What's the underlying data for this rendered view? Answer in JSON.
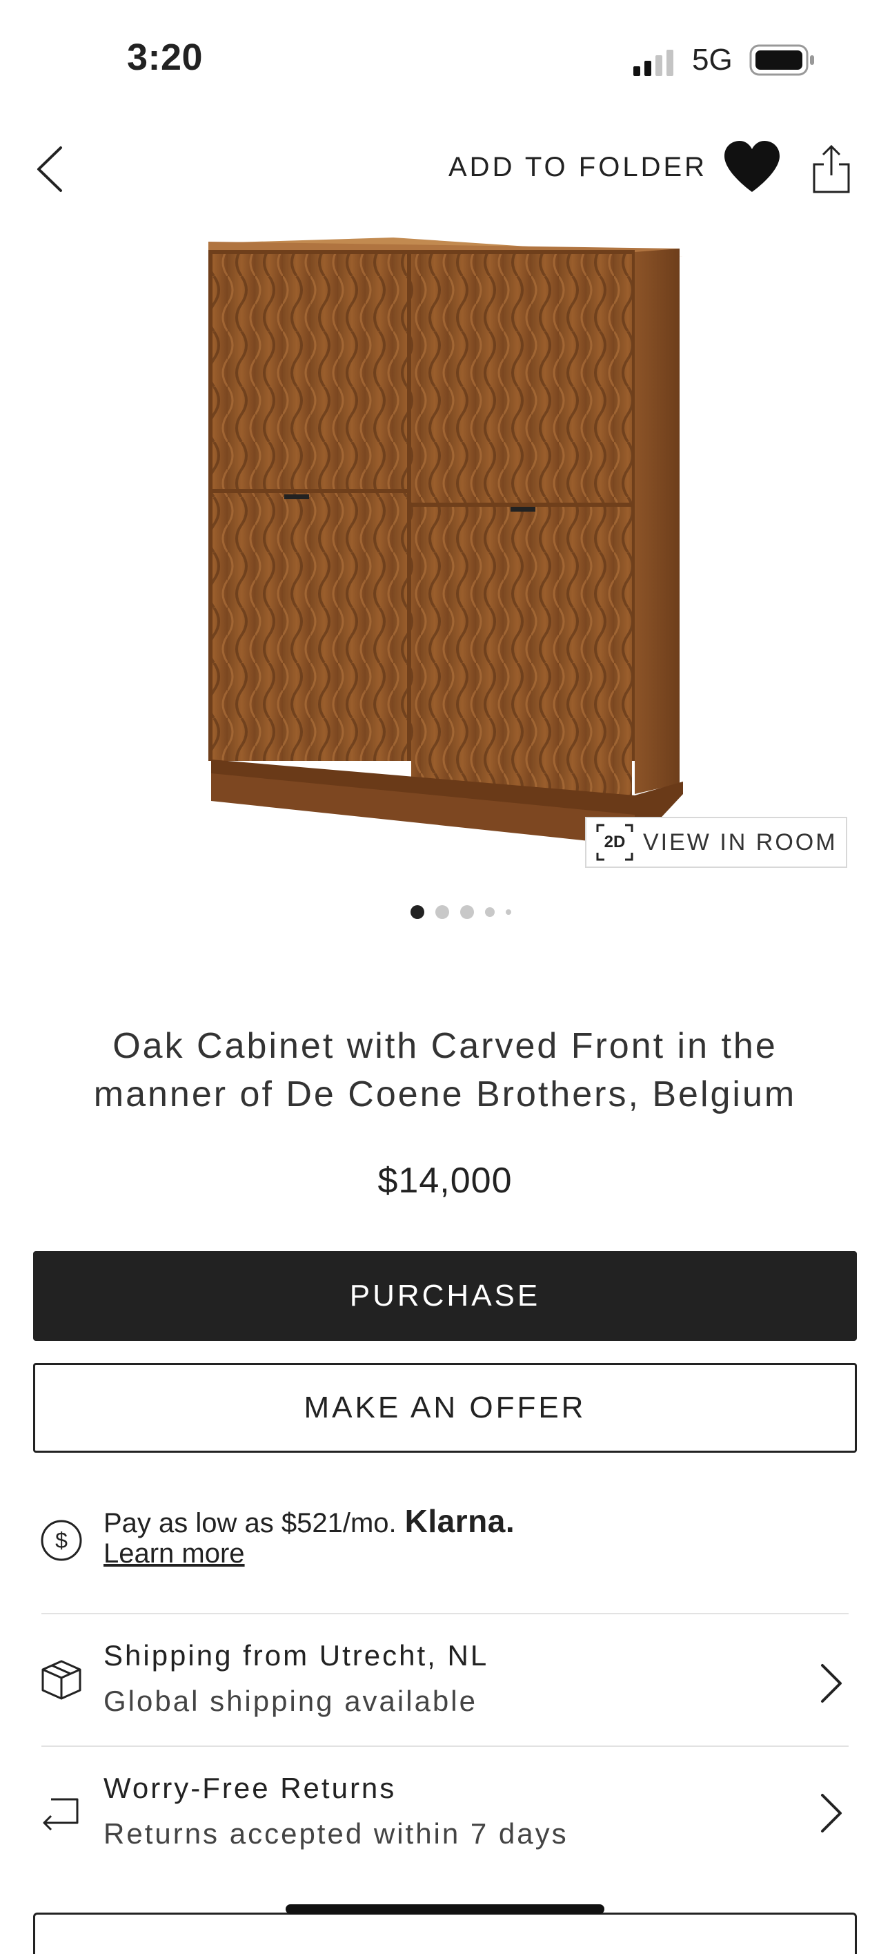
{
  "status_bar": {
    "time": "3:20",
    "network": "5G",
    "icons": [
      "signal-icon",
      "battery-icon"
    ]
  },
  "header": {
    "add_to_folder_label": "ADD TO FOLDER",
    "icons": [
      "back-chevron-icon",
      "heart-icon",
      "share-icon"
    ]
  },
  "product": {
    "view_in_room_label": "VIEW IN ROOM",
    "view_in_room_badge": "2D",
    "image_count": 5,
    "active_image": 1,
    "title": "Oak Cabinet with Carved Front in the manner of De Coene Brothers, Belgium",
    "price": "$14,000"
  },
  "actions": {
    "purchase_label": "PURCHASE",
    "offer_label": "MAKE AN OFFER"
  },
  "financing": {
    "text": "Pay as low as $521/mo.",
    "brand": "Klarna.",
    "learn_more": "Learn more",
    "icon": "dollar-circle-icon"
  },
  "details": [
    {
      "title": "Shipping from Utrecht, NL",
      "subtitle": "Global shipping available",
      "icon": "package-icon"
    },
    {
      "title": "Worry-Free Returns",
      "subtitle": "Returns accepted within 7 days",
      "icon": "return-arrow-icon"
    }
  ],
  "colors": {
    "primary": "#222222",
    "wood": "#8a5226",
    "divider": "#e2e2e2"
  }
}
